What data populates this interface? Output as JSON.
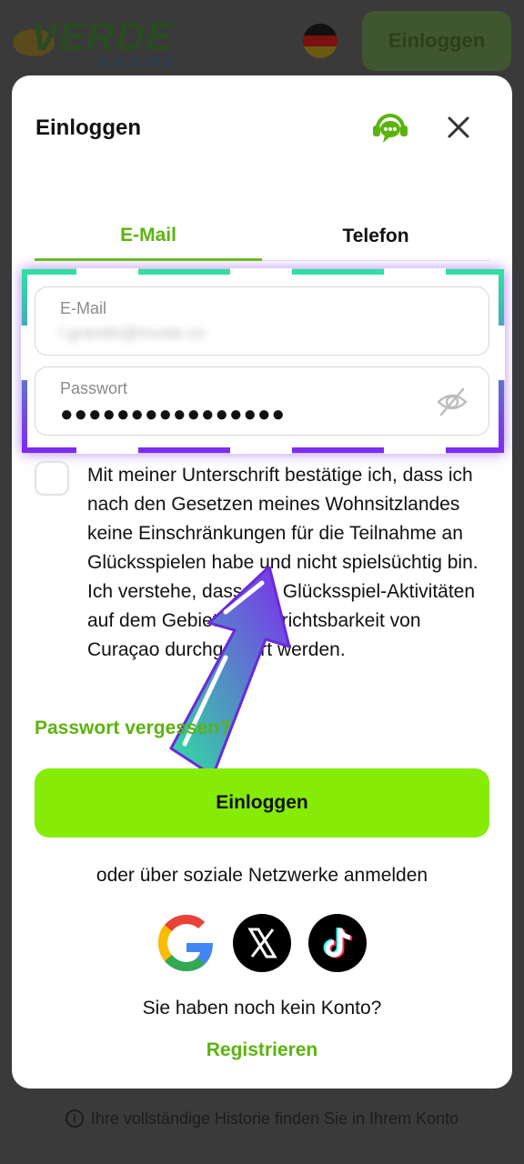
{
  "background": {
    "logo_word": "VERDE",
    "logo_sub": "CASINO",
    "login_button": "Einloggen",
    "footer_note": "Ihre vollständige Historie finden Sie in Ihrem Konto"
  },
  "modal": {
    "title": "Einloggen",
    "tabs": [
      {
        "label": "E-Mail",
        "active": true
      },
      {
        "label": "Telefon",
        "active": false
      }
    ],
    "email_field": {
      "label": "E-Mail",
      "value": "l.grandis@muste.co"
    },
    "password_field": {
      "label": "Passwort",
      "value": "●●●●●●●●●●●●●●●●"
    },
    "consent_text": "Mit meiner Unterschrift bestätige ich, dass ich nach den Gesetzen meines Wohnsitzlandes keine Einschränkungen für die Teilnahme an Glücksspielen habe und nicht spielsüchtig bin. Ich verstehe, dass alle Glücksspiel-Aktivitäten auf dem Gebiet der Gerichtsbarkeit von Curaçao durchgeführt werden.",
    "forgot_password": "Passwort vergessen?",
    "login_button": "Einloggen",
    "social_label": "oder über soziale Netzwerke anmelden",
    "no_account": "Sie haben noch kein Konto?",
    "register": "Registrieren"
  },
  "colors": {
    "accent_green": "#86ec07",
    "link_green": "#5cb30f",
    "highlight_top": "#2fe0a0",
    "highlight_bottom": "#7e2cf0"
  },
  "icons": [
    "support-headset-icon",
    "close-icon",
    "eye-off-icon",
    "google-icon",
    "x-icon",
    "tiktok-icon",
    "info-icon",
    "germany-flag-icon"
  ]
}
